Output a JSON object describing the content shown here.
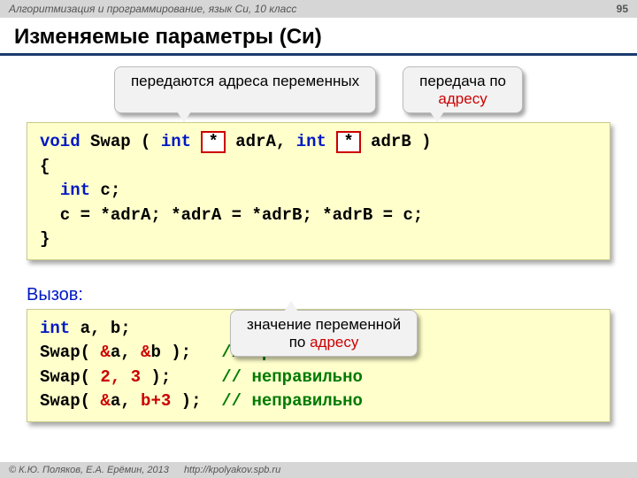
{
  "header": {
    "course": "Алгоритмизация и программирование, язык Си, 10 класс",
    "page": "95"
  },
  "title": "Изменяемые параметры (Си)",
  "annot": {
    "addr_passed": "передаются адреса переменных",
    "by_addr_1": "передача по",
    "by_addr_2": "адресу",
    "val_by_addr_1": "значение переменной",
    "val_by_addr_2": "адресу",
    "val_by_addr_pre": "по "
  },
  "code1": {
    "l1a": "void",
    "l1b": " Swap ( ",
    "l1c": "int",
    "l1d": " ",
    "l1star": "*",
    "l1e": " adrA, ",
    "l1f": "int",
    "l1g": " ",
    "l1star2": "*",
    "l1h": " adrB )",
    "l2": "{",
    "l3a": "  ",
    "l3b": "int",
    "l3c": " c;",
    "l4": "  c = *adrA; *adrA = *adrB; *adrB = c;",
    "l5": "}"
  },
  "call_label": "Вызов:",
  "code2": {
    "l1a": "int",
    "l1b": " a, b;",
    "l2a": "Swap( ",
    "l2amp1": "&",
    "l2b": "a, ",
    "l2amp2": "&",
    "l2c": "b );   ",
    "l2cmt": "// правильно",
    "l3a": "Swap( ",
    "l3n": "2, 3",
    "l3b": " );     ",
    "l3cmt": "// неправильно",
    "l4a": "Swap( ",
    "l4amp": "&",
    "l4b": "a, ",
    "l4exp": "b+3",
    "l4c": " );  ",
    "l4cmt": "// неправильно"
  },
  "footer": {
    "copy": "© К.Ю. Поляков, Е.А. Ерёмин, 2013",
    "url": "http://kpolyakov.spb.ru"
  }
}
